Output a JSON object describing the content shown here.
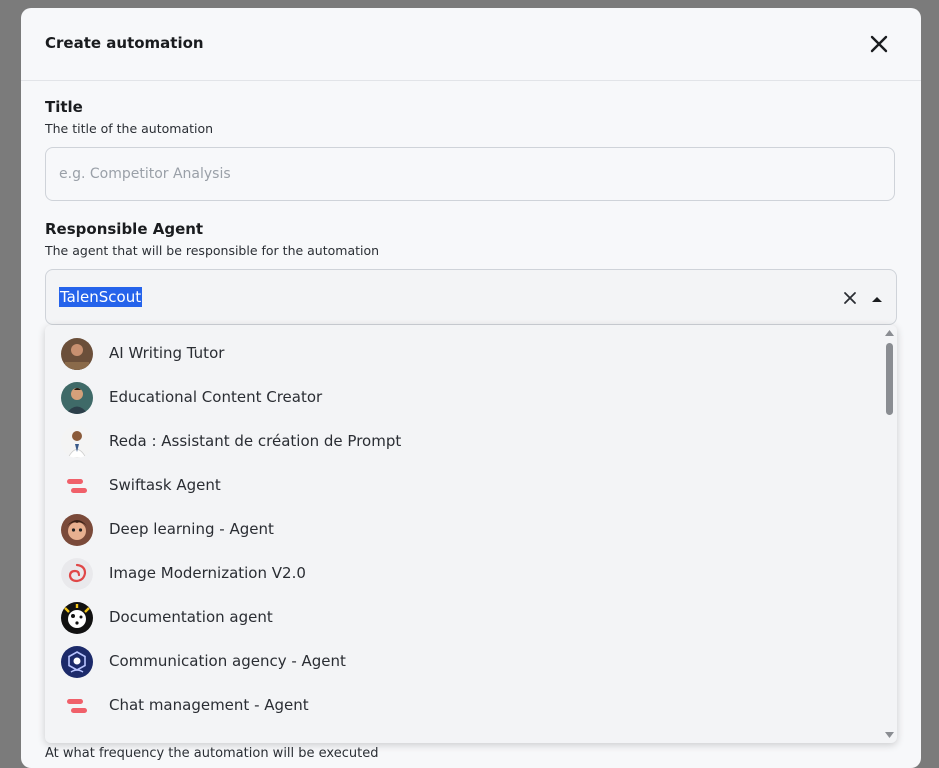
{
  "modal": {
    "title": "Create automation"
  },
  "title_field": {
    "label": "Title",
    "description": "The title of the automation",
    "placeholder": "e.g. Competitor Analysis",
    "value": ""
  },
  "agent_field": {
    "label": "Responsible Agent",
    "description": "The agent that will be responsible for the automation",
    "value": "TalenScout"
  },
  "options": [
    {
      "label": "AI Writing Tutor",
      "icon": "person-writing-avatar"
    },
    {
      "label": "Educational Content Creator",
      "icon": "person-desk-avatar"
    },
    {
      "label": "Reda : Assistant de création de Prompt",
      "icon": "doctor-avatar"
    },
    {
      "label": "Swiftask Agent",
      "icon": "swiftask-logo"
    },
    {
      "label": "Deep learning - Agent",
      "icon": "cartoon-face-avatar"
    },
    {
      "label": "Image Modernization V2.0",
      "icon": "red-swirl-logo"
    },
    {
      "label": "Documentation agent",
      "icon": "dalmatian-avatar"
    },
    {
      "label": "Communication agency - Agent",
      "icon": "hexagon-mascot-avatar"
    },
    {
      "label": "Chat management - Agent",
      "icon": "swiftask-logo"
    }
  ],
  "frequency_field": {
    "description": "At what frequency the automation will be executed"
  },
  "colors": {
    "selection": "#2563eb",
    "swiftask": "#f0606a"
  }
}
